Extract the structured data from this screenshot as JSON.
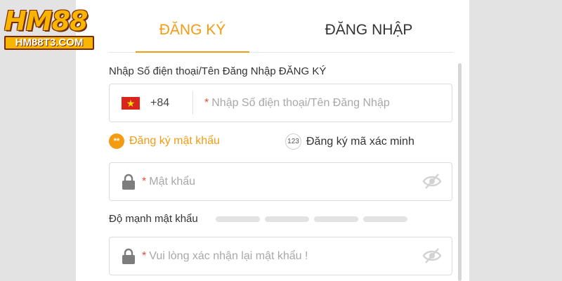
{
  "logo": {
    "main": "HM88",
    "sub": "HM88T3.COM"
  },
  "tabs": [
    {
      "label": "ĐĂNG KÝ",
      "active": true
    },
    {
      "label": "ĐĂNG NHẬP",
      "active": false
    }
  ],
  "account": {
    "label": "Nhập Số điện thoại/Tên Đăng Nhập ĐĂNG KÝ",
    "country_code": "+84",
    "required_mark": "*",
    "placeholder": "Nhập Số điện thoại/Tên Đăng Nhập"
  },
  "methods": {
    "password_option": "Đăng ký mật khẩu",
    "password_dots": "**",
    "code_option": "Đăng ký mã xác minh",
    "code_badge": "123"
  },
  "password": {
    "required_mark": "*",
    "placeholder": "Mật khẩu"
  },
  "strength": {
    "label": "Độ mạnh mật khẩu",
    "segments": 4
  },
  "confirm": {
    "required_mark": "*",
    "placeholder": "Vui lòng xác nhận lại mật khẩu !"
  },
  "colors": {
    "accent": "#f39c12",
    "required": "#e74c3c",
    "flag_red": "#da251d",
    "flag_star": "#ffde00"
  },
  "icons": {
    "flag": "vietnam-flag-icon",
    "lock": "lock-icon",
    "eye": "eye-slash-icon"
  }
}
